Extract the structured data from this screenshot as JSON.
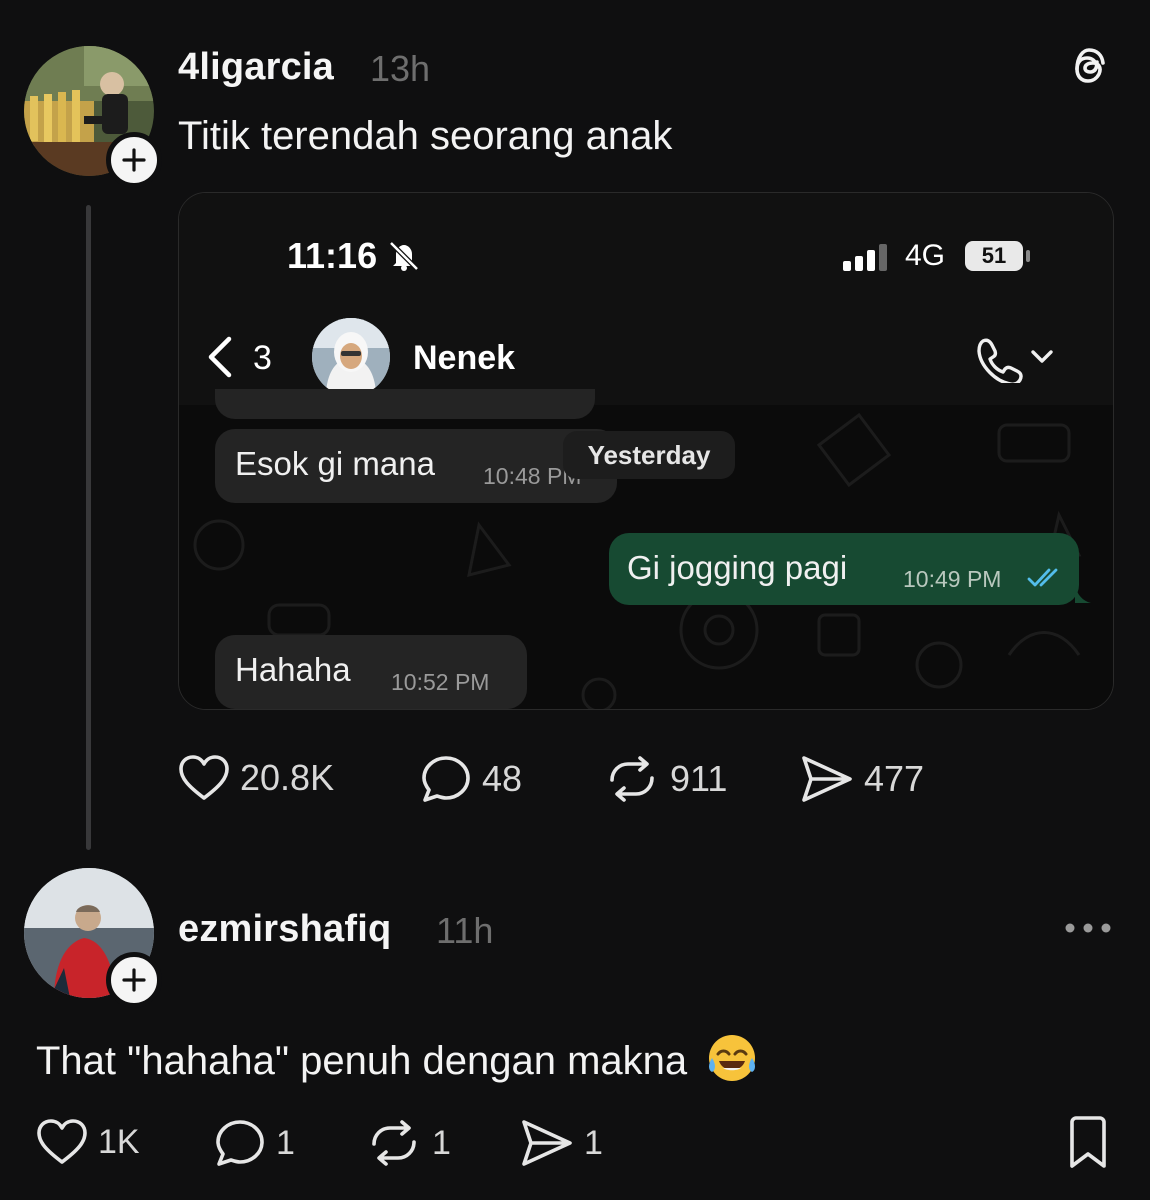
{
  "post": {
    "username": "4ligarcia",
    "time": "13h",
    "text": "Titik terendah seorang anak",
    "icons": {
      "avatar": "avatar",
      "follow": "plus-icon",
      "app_logo": "threads-logo"
    }
  },
  "embed": {
    "status_bar": {
      "time": "11:16",
      "network": "4G",
      "battery": "51",
      "icons": [
        "bell-slash-icon",
        "signal-icon",
        "battery-icon"
      ]
    },
    "chat_header": {
      "back_count": "3",
      "contact_name": "Nenek",
      "icons": [
        "back-chevron-icon",
        "phone-icon",
        "chevron-down-icon"
      ]
    },
    "date_separator": "Yesterday",
    "messages": [
      {
        "direction": "in",
        "text": "Esok gi mana",
        "time": "10:48 PM"
      },
      {
        "direction": "out",
        "text": "Gi jogging pagi",
        "time": "10:49 PM",
        "status": "read"
      },
      {
        "direction": "in",
        "text": "Hahaha",
        "time": "10:52 PM"
      }
    ],
    "colors": {
      "outgoing_bubble": "#174a32",
      "incoming_bubble": "#242424",
      "read_ticks": "#53bdeb"
    }
  },
  "post_actions": {
    "likes": "20.8K",
    "comments": "48",
    "reposts": "911",
    "shares": "477"
  },
  "reply": {
    "username": "ezmirshafiq",
    "time": "11h",
    "text": "That \"hahaha\" penuh dengan makna",
    "emoji": "face-with-tears-of-joy",
    "actions": {
      "likes": "1K",
      "comments": "1",
      "reposts": "1",
      "shares": "1"
    },
    "icons": {
      "more": "more-icon",
      "bookmark": "bookmark-icon"
    }
  }
}
